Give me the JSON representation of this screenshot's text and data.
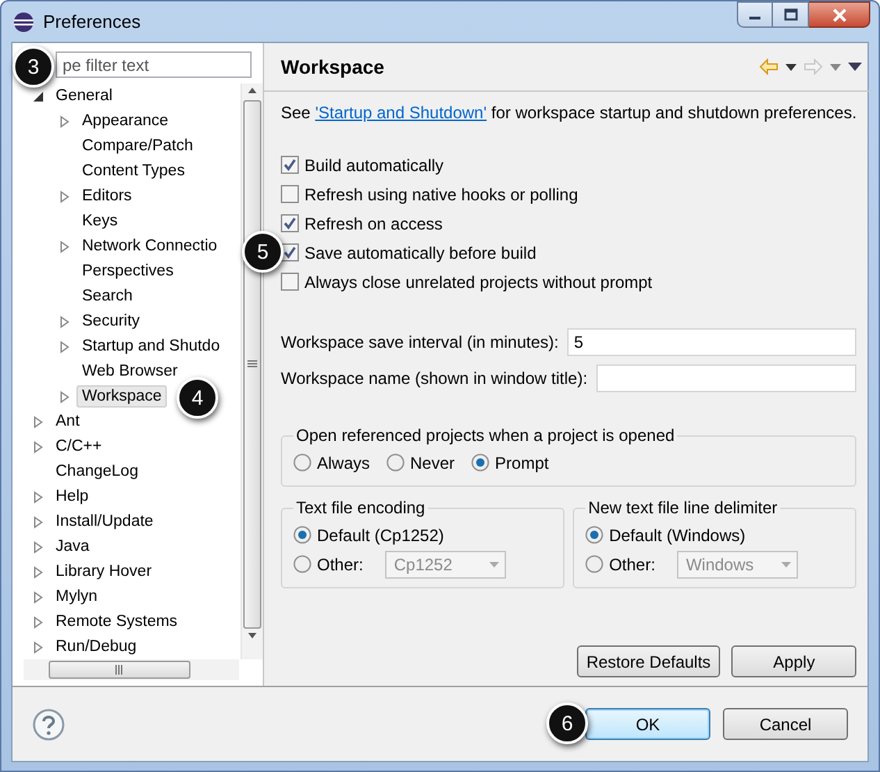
{
  "window": {
    "title": "Preferences"
  },
  "filter": {
    "placeholder": "pe filter text",
    "callout": "3"
  },
  "tree": {
    "items": [
      {
        "label": "General",
        "expanded": true,
        "selected": false,
        "children": [
          {
            "label": "Appearance",
            "expanded": false,
            "selected": false
          },
          {
            "label": "Compare/Patch",
            "selected": false
          },
          {
            "label": "Content Types",
            "selected": false
          },
          {
            "label": "Editors",
            "expanded": false,
            "selected": false
          },
          {
            "label": "Keys",
            "selected": false
          },
          {
            "label": "Network Connectio",
            "expanded": false,
            "selected": false
          },
          {
            "label": "Perspectives",
            "selected": false
          },
          {
            "label": "Search",
            "selected": false
          },
          {
            "label": "Security",
            "expanded": false,
            "selected": false
          },
          {
            "label": "Startup and Shutdo",
            "expanded": false,
            "selected": false
          },
          {
            "label": "Web Browser",
            "selected": false
          },
          {
            "label": "Workspace",
            "expanded": false,
            "selected": true,
            "callout": "4"
          }
        ]
      },
      {
        "label": "Ant",
        "expanded": false,
        "selected": false
      },
      {
        "label": "C/C++",
        "expanded": false,
        "selected": false
      },
      {
        "label": "ChangeLog",
        "selected": false
      },
      {
        "label": "Help",
        "expanded": false,
        "selected": false
      },
      {
        "label": "Install/Update",
        "expanded": false,
        "selected": false
      },
      {
        "label": "Java",
        "expanded": false,
        "selected": false
      },
      {
        "label": "Library Hover",
        "expanded": false,
        "selected": false
      },
      {
        "label": "Mylyn",
        "expanded": false,
        "selected": false
      },
      {
        "label": "Remote Systems",
        "expanded": false,
        "selected": false
      },
      {
        "label": "Run/Debug",
        "expanded": false,
        "selected": false
      }
    ]
  },
  "page": {
    "title": "Workspace",
    "intro": {
      "before": "See ",
      "link": "'Startup and Shutdown'",
      "after": " for workspace startup and shutdown preferences."
    },
    "checkboxes": [
      {
        "label": "Build automatically",
        "checked": true
      },
      {
        "label": "Refresh using native hooks or polling",
        "checked": false
      },
      {
        "label": "Refresh on access",
        "checked": true
      },
      {
        "label": "Save automatically before build",
        "checked": true,
        "callout": "5"
      },
      {
        "label": "Always close unrelated projects without prompt",
        "checked": false
      }
    ],
    "fields": [
      {
        "label": "Workspace save interval (in minutes):",
        "value": "5"
      },
      {
        "label": "Workspace name (shown in window title):"
      }
    ],
    "open_referenced": {
      "title": "Open referenced projects when a project is opened",
      "options": [
        {
          "label": "Always",
          "selected": false
        },
        {
          "label": "Never",
          "selected": false
        },
        {
          "label": "Prompt",
          "selected": true
        }
      ]
    },
    "encoding": {
      "title": "Text file encoding",
      "options": [
        {
          "label": "Default (Cp1252)",
          "selected": true
        },
        {
          "label": "Other:",
          "selected": false,
          "combo": "Cp1252"
        }
      ]
    },
    "line_delimiter": {
      "title": "New text file line delimiter",
      "options": [
        {
          "label": "Default (Windows)",
          "selected": true
        },
        {
          "label": "Other:",
          "selected": false,
          "combo": "Windows"
        }
      ]
    },
    "buttons": [
      "Restore Defaults",
      "Apply"
    ]
  },
  "dialog_buttons": [
    {
      "label": "OK",
      "default": true,
      "callout": "6"
    },
    {
      "label": "Cancel",
      "default": false
    }
  ]
}
